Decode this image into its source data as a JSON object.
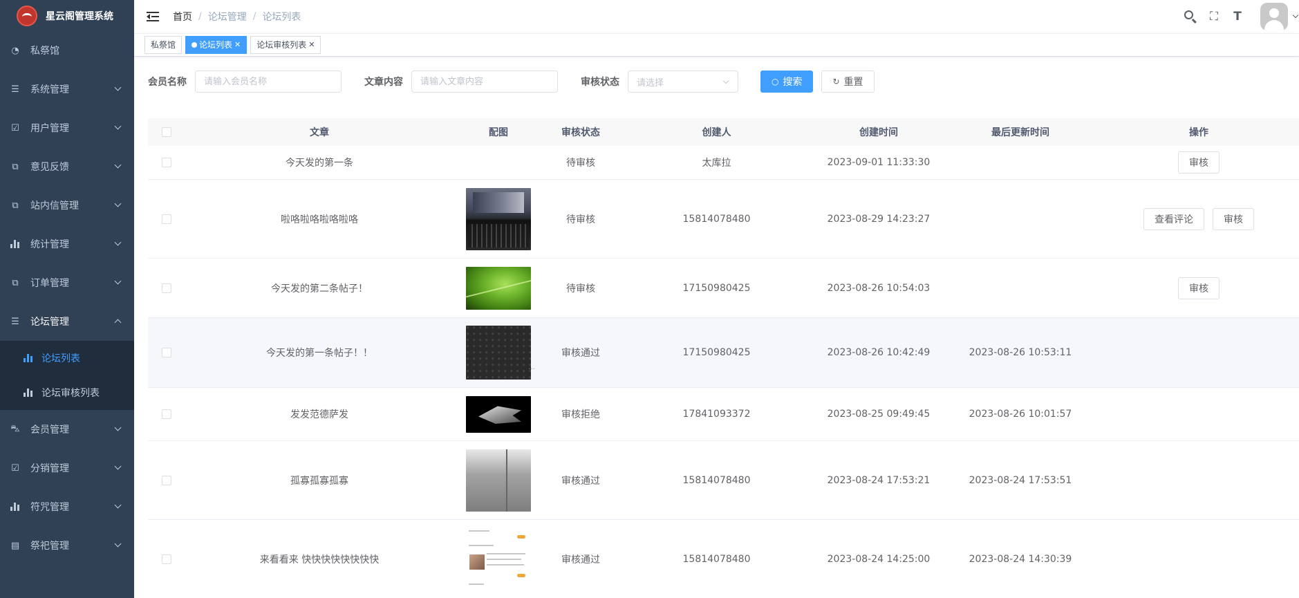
{
  "app": {
    "title": "星云阁管理系统"
  },
  "sidebar": {
    "items": [
      {
        "label": "私祭馆",
        "icon": "dashboard-icon"
      },
      {
        "label": "系统管理",
        "icon": "list-icon"
      },
      {
        "label": "用户管理",
        "icon": "checkbox-icon"
      },
      {
        "label": "意见反馈",
        "icon": "puzzle-icon"
      },
      {
        "label": "站内信管理",
        "icon": "puzzle-icon"
      },
      {
        "label": "统计管理",
        "icon": "chart-icon"
      },
      {
        "label": "订单管理",
        "icon": "puzzle-icon"
      },
      {
        "label": "论坛管理",
        "icon": "tree-icon"
      }
    ],
    "forum_sub": [
      {
        "label": "论坛列表",
        "active": true
      },
      {
        "label": "论坛审核列表",
        "active": false
      }
    ],
    "items_after": [
      {
        "label": "会员管理",
        "icon": "car-icon"
      },
      {
        "label": "分销管理",
        "icon": "checkbox-icon"
      },
      {
        "label": "符咒管理",
        "icon": "chart-icon"
      },
      {
        "label": "祭祀管理",
        "icon": "server-icon"
      }
    ]
  },
  "breadcrumb": [
    "首页",
    "论坛管理",
    "论坛列表"
  ],
  "tags": [
    "私祭馆",
    "论坛列表",
    "论坛审核列表"
  ],
  "filter": {
    "member_label": "会员名称",
    "member_placeholder": "请输入会员名称",
    "content_label": "文章内容",
    "content_placeholder": "请输入文章内容",
    "status_label": "审核状态",
    "status_placeholder": "请选择",
    "search": "搜索",
    "reset": "重置"
  },
  "table": {
    "headers": [
      "文章",
      "配图",
      "审核状态",
      "创建人",
      "创建时间",
      "最后更新时间",
      "操作"
    ],
    "rows": [
      {
        "article": "今天发的第一条",
        "image": "",
        "status": "待审核",
        "creator": "太库拉",
        "created": "2023-09-01 11:33:30",
        "updated": "",
        "actions": [
          "审核"
        ]
      },
      {
        "article": "啦咯啦咯啦咯啦咯",
        "image": "laptop",
        "status": "待审核",
        "creator": "15814078480",
        "created": "2023-08-29 14:23:27",
        "updated": "",
        "actions": [
          "查看评论",
          "审核"
        ]
      },
      {
        "article": "今天发的第二条帖子！",
        "image": "leaf",
        "status": "待审核",
        "creator": "17150980425",
        "created": "2023-08-26 10:54:03",
        "updated": "",
        "actions": [
          "审核"
        ]
      },
      {
        "article": "今天发的第一条帖子！！",
        "image": "dark",
        "status": "审核通过",
        "creator": "17150980425",
        "created": "2023-08-26 10:42:49",
        "updated": "2023-08-26 10:53:11",
        "actions": []
      },
      {
        "article": "发发范德萨发",
        "image": "ship",
        "status": "审核拒绝",
        "creator": "17841093372",
        "created": "2023-08-25 09:49:45",
        "updated": "2023-08-26 10:01:57",
        "actions": []
      },
      {
        "article": "孤寡孤寡孤寡",
        "image": "room",
        "status": "审核通过",
        "creator": "15814078480",
        "created": "2023-08-24 17:53:21",
        "updated": "2023-08-24 17:53:51",
        "actions": []
      },
      {
        "article": "来看看来 快快快快快快快快",
        "image": "doc",
        "status": "审核通过",
        "creator": "15814078480",
        "created": "2023-08-24 14:25:00",
        "updated": "2023-08-24 14:30:39",
        "actions": []
      }
    ]
  }
}
